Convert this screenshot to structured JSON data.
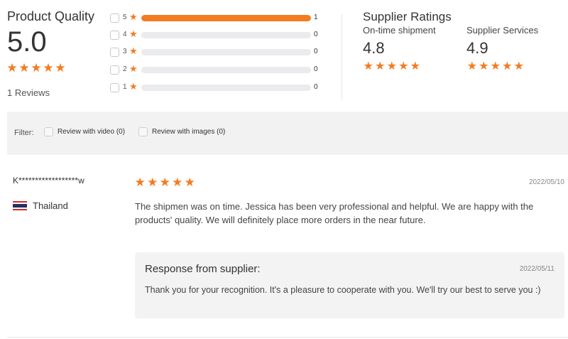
{
  "product_quality": {
    "title": "Product Quality",
    "score": "5.0",
    "stars": 5,
    "reviews_label": "1 Reviews"
  },
  "distribution": [
    {
      "stars": "5",
      "count": "1",
      "fraction": 1.0
    },
    {
      "stars": "4",
      "count": "0",
      "fraction": 0
    },
    {
      "stars": "3",
      "count": "0",
      "fraction": 0
    },
    {
      "stars": "2",
      "count": "0",
      "fraction": 0
    },
    {
      "stars": "1",
      "count": "0",
      "fraction": 0
    }
  ],
  "supplier_ratings": {
    "title": "Supplier Ratings",
    "on_time": {
      "label": "On-time shipment",
      "score": "4.8",
      "stars": 5
    },
    "services": {
      "label": "Supplier Services",
      "score": "4.9",
      "stars": 5
    }
  },
  "filter": {
    "label": "Filter:",
    "options": [
      {
        "label": "Review with video (0)"
      },
      {
        "label": "Review with images (0)"
      }
    ]
  },
  "review": {
    "reviewer": "K******************w",
    "country": "Thailand",
    "stars": 5,
    "date": "2022/05/10",
    "text": "The shipmen was on time. Jessica has been very professional and helpful. We are happy with the products' quality. We will definitely place more orders in the near future.",
    "response": {
      "title": "Response from supplier:",
      "date": "2022/05/11",
      "text": "Thank you for your recognition. It's a pleasure to cooperate with you. We'll try our best to serve you :)"
    }
  },
  "colors": {
    "accent": "#f47b20",
    "bar_track": "#ebebee",
    "panel_bg": "#f2f2f2"
  },
  "icons": {
    "star": "star-icon",
    "flag": "thailand-flag-icon",
    "checkbox": "checkbox-icon"
  }
}
